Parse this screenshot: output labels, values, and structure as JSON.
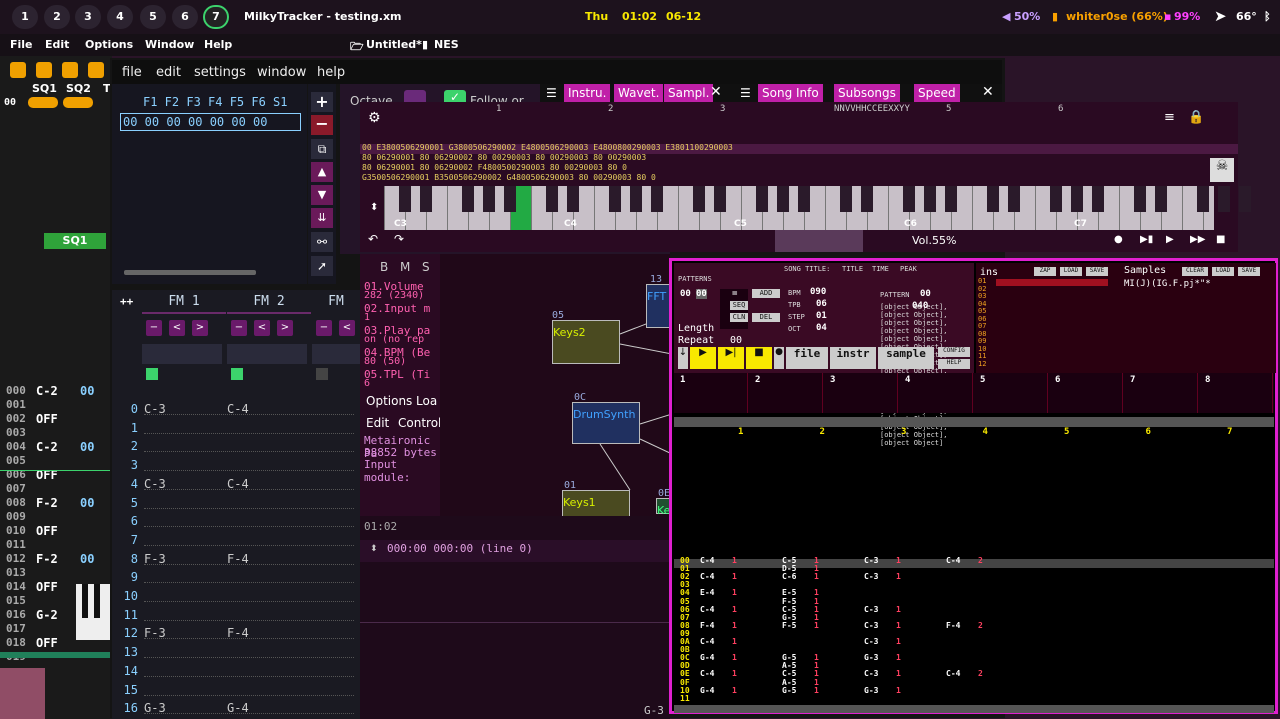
{
  "topbar": {
    "workspaces": [
      "1",
      "2",
      "3",
      "4",
      "5",
      "6",
      "7"
    ],
    "title": "MilkyTracker - testing.xm",
    "day": "Thu",
    "time": "01:02",
    "date": "06-12",
    "volume": "50%",
    "wifi": "whiter0se (66%)",
    "battery": "99%",
    "temp": "66°"
  },
  "outer_menu": {
    "file": "File",
    "edit": "Edit",
    "options": "Options",
    "window": "Window",
    "help": "Help",
    "doc": "Untitled*",
    "system": "NES"
  },
  "left_tracker": {
    "channels": [
      "SQ1",
      "SQ2",
      "T"
    ],
    "chip_value": "00",
    "tab": "SQ1",
    "rows": [
      {
        "n": "000",
        "note": "C-2",
        "v": "00"
      },
      {
        "n": "001",
        "note": "",
        "v": ""
      },
      {
        "n": "002",
        "note": "OFF",
        "v": ""
      },
      {
        "n": "003",
        "note": "",
        "v": ""
      },
      {
        "n": "004",
        "note": "C-2",
        "v": "00"
      },
      {
        "n": "005",
        "note": "",
        "v": ""
      },
      {
        "n": "006",
        "note": "OFF",
        "v": ""
      },
      {
        "n": "007",
        "note": "",
        "v": ""
      },
      {
        "n": "008",
        "note": "F-2",
        "v": "00"
      },
      {
        "n": "009",
        "note": "",
        "v": ""
      },
      {
        "n": "010",
        "note": "OFF",
        "v": ""
      },
      {
        "n": "011",
        "note": "",
        "v": ""
      },
      {
        "n": "012",
        "note": "F-2",
        "v": "00"
      },
      {
        "n": "013",
        "note": "",
        "v": ""
      },
      {
        "n": "014",
        "note": "OFF",
        "v": ""
      },
      {
        "n": "015",
        "note": "",
        "v": ""
      },
      {
        "n": "016",
        "note": "G-2",
        "v": ""
      },
      {
        "n": "017",
        "note": "",
        "v": ""
      },
      {
        "n": "018",
        "note": "OFF",
        "v": ""
      },
      {
        "n": "019",
        "note": "",
        "v": ""
      }
    ]
  },
  "mt_menu": {
    "file": "file",
    "edit": "edit",
    "settings": "settings",
    "window": "window",
    "help": "help"
  },
  "fkeys": {
    "labels": "F1 F2 F3 F4 F5 F6 S1",
    "values": "00 00 00 00 00 00 00"
  },
  "fm": {
    "headers": [
      "FM 1",
      "FM 2",
      "FM"
    ],
    "plus": "++",
    "rows": [
      {
        "n": "0",
        "a": "C-3",
        "b": "C-4"
      },
      {
        "n": "1",
        "a": "",
        "b": ""
      },
      {
        "n": "2",
        "a": "",
        "b": ""
      },
      {
        "n": "3",
        "a": "",
        "b": ""
      },
      {
        "n": "4",
        "a": "C-3",
        "b": "C-4"
      },
      {
        "n": "5",
        "a": "",
        "b": ""
      },
      {
        "n": "6",
        "a": "",
        "b": ""
      },
      {
        "n": "7",
        "a": "",
        "b": ""
      },
      {
        "n": "8",
        "a": "F-3",
        "b": "F-4"
      },
      {
        "n": "9",
        "a": "",
        "b": ""
      },
      {
        "n": "10",
        "a": "",
        "b": ""
      },
      {
        "n": "11",
        "a": "",
        "b": ""
      },
      {
        "n": "12",
        "a": "F-3",
        "b": "F-4"
      },
      {
        "n": "13",
        "a": "",
        "b": ""
      },
      {
        "n": "14",
        "a": "",
        "b": ""
      },
      {
        "n": "15",
        "a": "",
        "b": ""
      },
      {
        "n": "16",
        "a": "G-3",
        "b": "G-4"
      }
    ]
  },
  "tabs": {
    "octave": "Octave",
    "follow": "Follow or",
    "instr": "Instru.",
    "wavet": "Wavet.",
    "sampl": "Sampl.",
    "songinfo": "Song Info",
    "subsongs": "Subsongs",
    "speed": "Speed"
  },
  "pattern": {
    "header": "NNVVHHCCEEXXYY",
    "cols": [
      "1",
      "2",
      "3",
      "5",
      "6"
    ],
    "lines": [
      "00 E3800506290001  G3800506290002  E4800506290003  E4800800290003  E3801100290003",
      "   80    06290001    80    06290002    80    00290003    80    00290003    80   00290003",
      "   80    06290001    80    06290002  F4800500290003    80    00290003    80   0",
      "   G3500506290001  B3500506290002  G4800506290003    80    00290003    80   0"
    ],
    "keys": [
      "C3",
      "C4",
      "C5",
      "C6",
      "C7"
    ],
    "vol": "Vol.55%"
  },
  "mod_list": {
    "bmst": [
      "B",
      "M",
      "S"
    ],
    "items": [
      {
        "t": "01.Volume",
        "s": "282 (2340)"
      },
      {
        "t": "02.Input m",
        "s": "1"
      },
      {
        "t": "03.Play pa",
        "s": "on (no rep"
      },
      {
        "t": "04.BPM (Be",
        "s": "80 (50)"
      },
      {
        "t": "05.TPL (Ti",
        "s": "6"
      }
    ],
    "options": "Options",
    "load": "Loa",
    "edit": "Edit",
    "control": "Control",
    "info": [
      "Metaironic Pa",
      "38852 bytes",
      "Input module:"
    ]
  },
  "nodes": {
    "keys2": "Keys2",
    "keys2_id": "05",
    "drum": "DrumSynth",
    "drum_id": "0C",
    "keys1": "Keys1",
    "keys1_id": "01",
    "fft": "FFT",
    "fft_id": "13",
    "ke": "Ke",
    "ke_id": "0E"
  },
  "timeline": {
    "time": "01:02",
    "pos": "000:00 000:00 (line 0)"
  },
  "pt": {
    "patterns": "PATTERNS",
    "songtitle": "SONG TITLE:",
    "title": "TITLE",
    "time": "TIME",
    "peak": "PEAK",
    "bpm": "BPM",
    "bpm_v": "090",
    "tpb": "TPB",
    "tpb_v": "06",
    "step": "STEP",
    "step_v": "01",
    "oct": "OCT",
    "oct_v": "04",
    "pattern": "PATTERN",
    "pattern_v": "00",
    "rows": [
      {
        "n": "00",
        "c1": "C-4",
        "i1": "1",
        "c2": "C-5",
        "i2": "1",
        "c3": "C-3",
        "i3": "1",
        "c4": "C-4",
        "i4": "2"
      },
      {
        "n": "01",
        "c1": "",
        "i1": "",
        "c2": "D-5",
        "i2": "1",
        "c3": "",
        "i3": "",
        "c4": "",
        "i4": ""
      },
      {
        "n": "02",
        "c1": "C-4",
        "i1": "1",
        "c2": "C-6",
        "i2": "1",
        "c3": "C-3",
        "i3": "1",
        "c4": "",
        "i4": ""
      },
      {
        "n": "03",
        "c1": "",
        "i1": "",
        "c2": "",
        "i2": "",
        "c3": "",
        "i3": "",
        "c4": "",
        "i4": ""
      },
      {
        "n": "04",
        "c1": "E-4",
        "i1": "1",
        "c2": "E-5",
        "i2": "1",
        "c3": "",
        "i3": "",
        "c4": "",
        "i4": ""
      },
      {
        "n": "05",
        "c1": "",
        "i1": "",
        "c2": "F-5",
        "i2": "1",
        "c3": "",
        "i3": "",
        "c4": "",
        "i4": ""
      },
      {
        "n": "06",
        "c1": "C-4",
        "i1": "1",
        "c2": "C-5",
        "i2": "1",
        "c3": "C-3",
        "i3": "1",
        "c4": "",
        "i4": ""
      },
      {
        "n": "07",
        "c1": "",
        "i1": "",
        "c2": "G-5",
        "i2": "1",
        "c3": "",
        "i3": "",
        "c4": "",
        "i4": ""
      },
      {
        "n": "08",
        "c1": "F-4",
        "i1": "1",
        "c2": "F-5",
        "i2": "1",
        "c3": "C-3",
        "i3": "1",
        "c4": "F-4",
        "i4": "2"
      },
      {
        "n": "09",
        "c1": "",
        "i1": "",
        "c2": "",
        "i2": "",
        "c3": "",
        "i3": "",
        "c4": "",
        "i4": ""
      },
      {
        "n": "0A",
        "c1": "C-4",
        "i1": "1",
        "c2": "",
        "i2": "",
        "c3": "C-3",
        "i3": "1",
        "c4": "",
        "i4": ""
      },
      {
        "n": "0B",
        "c1": "",
        "i1": "",
        "c2": "",
        "i2": "",
        "c3": "",
        "i3": "",
        "c4": "",
        "i4": ""
      },
      {
        "n": "0C",
        "c1": "G-4",
        "i1": "1",
        "c2": "G-5",
        "i2": "1",
        "c3": "G-3",
        "i3": "1",
        "c4": "",
        "i4": ""
      },
      {
        "n": "0D",
        "c1": "",
        "i1": "",
        "c2": "A-5",
        "i2": "1",
        "c3": "",
        "i3": "",
        "c4": "",
        "i4": ""
      },
      {
        "n": "0E",
        "c1": "C-4",
        "i1": "1",
        "c2": "C-5",
        "i2": "1",
        "c3": "C-3",
        "i3": "1",
        "c4": "C-4",
        "i4": "2"
      },
      {
        "n": "0F",
        "c1": "",
        "i1": "",
        "c2": "A-5",
        "i2": "1",
        "c3": "",
        "i3": "",
        "c4": "",
        "i4": ""
      },
      {
        "n": "10",
        "c1": "G-4",
        "i1": "1",
        "c2": "G-5",
        "i2": "1",
        "c3": "G-3",
        "i3": "1",
        "c4": "",
        "i4": ""
      },
      {
        "n": "11",
        "c1": "",
        "i1": "",
        "c2": "",
        "i2": "",
        "c3": "",
        "i3": "",
        "c4": "",
        "i4": ""
      }
    ],
    "rows_v": "040",
    "pat_v": "00",
    "pat_v2": "00",
    "add": "ADD",
    "seq": "SEQ",
    "cln": "CLN",
    "del": "DEL",
    "length": "Length",
    "repeat": "Repeat",
    "repeat_v": "00",
    "file": "file",
    "instr": "instr",
    "sample": "sample",
    "config": "CONFIG",
    "help": "HELP",
    "ins": "ins",
    "zap": "ZAP",
    "load": "LOAD",
    "save": "SAVE",
    "samples": "Samples",
    "clear": "CLEAR",
    "sample_name": "MI(J)(IG.F.pj*\"*",
    "inslist": [
      "01",
      "02",
      "03",
      "04",
      "05",
      "06",
      "07",
      "08",
      "09",
      "10",
      "11",
      "12"
    ],
    "chans": [
      "1",
      "2",
      "3",
      "4",
      "5",
      "6",
      "7",
      "8"
    ]
  },
  "bottom": {
    "g3": "G-3"
  },
  "colors": {
    "accent": "#e020d0",
    "pink_bg": "#2a0a1e",
    "yellow": "#f8e800",
    "green": "#3cd36c"
  }
}
